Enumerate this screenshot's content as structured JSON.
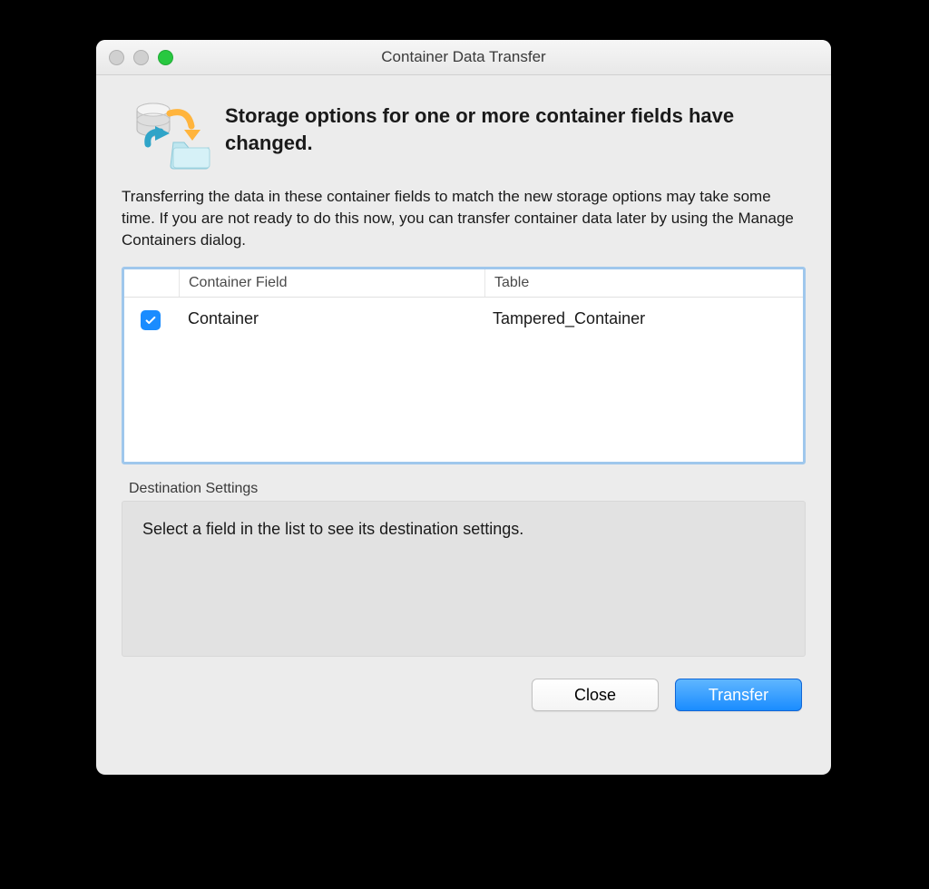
{
  "window": {
    "title": "Container Data Transfer"
  },
  "header": {
    "message": "Storage options for one or more container fields have changed."
  },
  "description": "Transferring the data in these container fields to match the new storage options may take some time. If you are not ready to do this now, you can transfer container data later by using the Manage Containers dialog.",
  "list": {
    "columns": {
      "container_field": "Container Field",
      "table": "Table"
    },
    "rows": [
      {
        "checked": true,
        "container_field": "Container",
        "table": "Tampered_Container"
      }
    ]
  },
  "destination": {
    "label": "Destination Settings",
    "placeholder": "Select a field in the list to see its destination settings."
  },
  "buttons": {
    "close": "Close",
    "transfer": "Transfer"
  }
}
